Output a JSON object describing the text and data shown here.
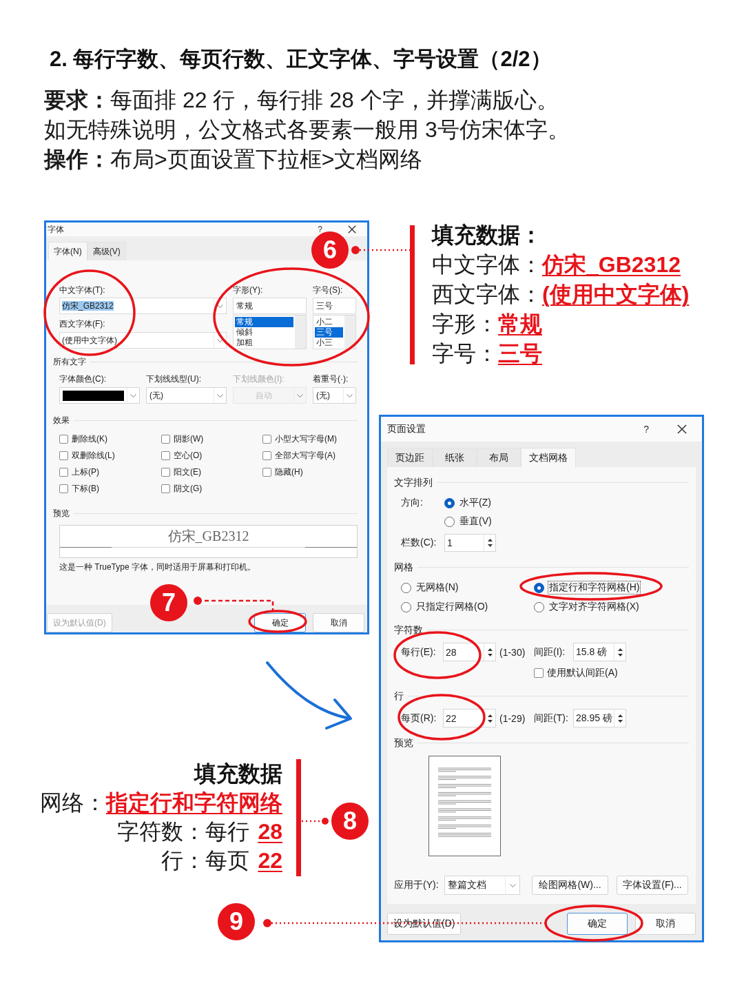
{
  "title": "2. 每行字数、每页行数、正文字体、字号设置（2/2）",
  "instructions": [
    "**要求：**每面排 22 行，每行排 28 个字，并撑满版心。",
    "如无特殊说明，公文格式各要素一般用 3号仿宋体字。",
    "**操作：**布局>页面设置下拉框>文档网络"
  ],
  "font_dialog": {
    "title": "字体",
    "help": "?",
    "tabs": [
      {
        "label": "字体(N)",
        "selected": true
      },
      {
        "label": "高级(V)",
        "selected": false
      }
    ],
    "chinese_font": {
      "label": "中文字体(T):",
      "value": "仿宋_GB2312",
      "highlighted": true
    },
    "western_font": {
      "label": "西文字体(F):",
      "value": "(使用中文字体)",
      "highlighted": false
    },
    "style": {
      "label": "字形(Y):",
      "value": "常规",
      "options": [
        {
          "label": "常规",
          "selected": true
        },
        {
          "label": "倾斜",
          "selected": false
        },
        {
          "label": "加粗",
          "selected": false
        }
      ]
    },
    "size": {
      "label": "字号(S):",
      "value": "三号",
      "options": [
        {
          "label": "小二",
          "selected": false
        },
        {
          "label": "三号",
          "selected": true
        },
        {
          "label": "小三",
          "selected": false
        }
      ]
    },
    "all_text": {
      "title": "所有文字",
      "fields": [
        {
          "label": "字体颜色(C):",
          "kind": "color",
          "color": "#000000",
          "disabled": false
        },
        {
          "label": "下划线线型(U):",
          "kind": "select",
          "value": "(无)",
          "disabled": false
        },
        {
          "label": "下划线颜色(I):",
          "kind": "color",
          "value": "自动",
          "disabled": true
        },
        {
          "label": "着重号(·):",
          "kind": "select",
          "value": "(无)",
          "disabled": false
        }
      ]
    },
    "effects": {
      "title": "效果",
      "options": [
        {
          "label": "删除线(K)",
          "checked": false
        },
        {
          "label": "阴影(W)",
          "checked": false
        },
        {
          "label": "小型大写字母(M)",
          "checked": false
        },
        {
          "label": "双删除线(L)",
          "checked": false
        },
        {
          "label": "空心(O)",
          "checked": false
        },
        {
          "label": "全部大写字母(A)",
          "checked": false
        },
        {
          "label": "上标(P)",
          "checked": false
        },
        {
          "label": "阳文(E)",
          "checked": false
        },
        {
          "label": "隐藏(H)",
          "checked": false
        },
        {
          "label": "下标(B)",
          "checked": false
        },
        {
          "label": "阴文(G)",
          "checked": false
        }
      ]
    },
    "preview": {
      "title": "预览",
      "sample": "仿宋_GB2312",
      "note": "这是一种 TrueType 字体，同时适用于屏幕和打印机。"
    },
    "buttons": [
      {
        "label": "设为默认值(D)",
        "disabled": true,
        "default": false
      },
      {
        "label": "确定",
        "disabled": false,
        "default": true
      },
      {
        "label": "取消",
        "disabled": false,
        "default": false
      }
    ]
  },
  "font_answers": {
    "heading": "填充数据：",
    "rows": [
      {
        "label": "中文字体：",
        "value": "仿宋_GB2312"
      },
      {
        "label": "西文字体：",
        "value": "(使用中文字体)"
      },
      {
        "label": "字形：",
        "value": "常规"
      },
      {
        "label": "字号：",
        "value": "三号"
      }
    ]
  },
  "page_setup_dialog": {
    "title": "页面设置",
    "help": "?",
    "tabs": [
      {
        "label": "页边距",
        "selected": false
      },
      {
        "label": "纸张",
        "selected": false
      },
      {
        "label": "布局",
        "selected": false
      },
      {
        "label": "文档网格",
        "selected": true
      }
    ],
    "text_direction": {
      "title": "文字排列",
      "direction_label": "方向:",
      "options": [
        {
          "label": "水平(Z)",
          "selected": true
        },
        {
          "label": "垂直(V)",
          "selected": false
        }
      ],
      "columns_label": "栏数(C):",
      "columns_value": "1"
    },
    "grid": {
      "title": "网格",
      "options": [
        {
          "label": "无网格(N)",
          "selected": false,
          "focused": false
        },
        {
          "label": "指定行和字符网格(H)",
          "selected": true,
          "focused": true
        },
        {
          "label": "只指定行网格(O)",
          "selected": false,
          "focused": false
        },
        {
          "label": "文字对齐字符网格(X)",
          "selected": false,
          "focused": false
        }
      ]
    },
    "characters": {
      "title": "字符数",
      "count_label": "每行(E):",
      "count": "28",
      "range": "(1-30)",
      "pitch_label": "间距(I):",
      "pitch": "15.8 磅",
      "default_pitch": {
        "label": "使用默认间距(A)",
        "checked": false
      }
    },
    "lines": {
      "title": "行",
      "count_label": "每页(R):",
      "count": "22",
      "range": "(1-29)",
      "pitch_label": "间距(T):",
      "pitch": "28.95 磅"
    },
    "preview": {
      "title": "预览"
    },
    "apply_to": {
      "label": "应用于(Y):",
      "value": "整篇文档"
    },
    "actions": [
      "绘图网格(W)...",
      "字体设置(F)..."
    ],
    "buttons": [
      {
        "label": "设为默认值(D)",
        "disabled": false,
        "default": false
      },
      {
        "label": "确定",
        "disabled": false,
        "default": true
      },
      {
        "label": "取消",
        "disabled": false,
        "default": false
      }
    ]
  },
  "grid_answers": {
    "heading": "填充数据",
    "rows": [
      {
        "label": "网络：",
        "value": "指定行和字符网络"
      },
      {
        "label": "字符数：",
        "prefix": "每行",
        "value": "28"
      },
      {
        "label": "行：",
        "prefix": "每页",
        "value": "22"
      }
    ]
  },
  "steps": [
    "6",
    "7",
    "8",
    "9"
  ]
}
